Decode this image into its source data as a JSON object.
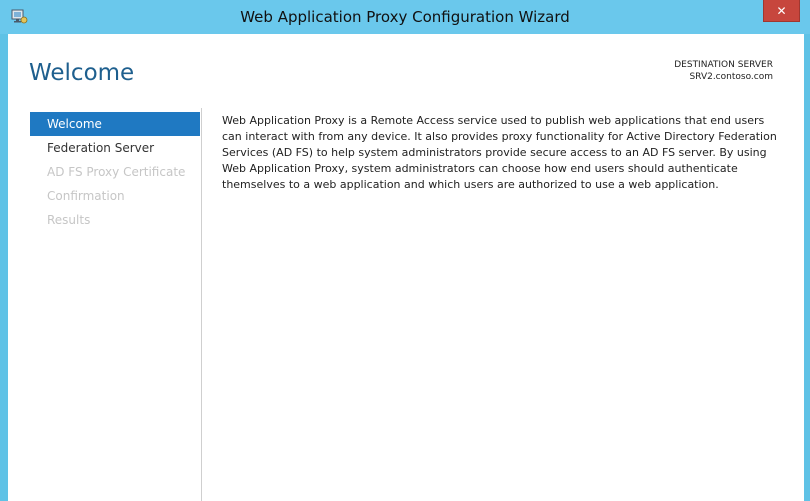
{
  "window": {
    "title": "Web Application Proxy Configuration Wizard",
    "close_glyph": "✕",
    "icon": "wizard-app-icon"
  },
  "header": {
    "page_title": "Welcome",
    "destination_label": "DESTINATION SERVER",
    "destination_value": "SRV2.contoso.com"
  },
  "nav": {
    "items": [
      {
        "label": "Welcome",
        "state": "active"
      },
      {
        "label": "Federation Server",
        "state": "enabled"
      },
      {
        "label": "AD FS Proxy Certificate",
        "state": "disabled"
      },
      {
        "label": "Confirmation",
        "state": "disabled"
      },
      {
        "label": "Results",
        "state": "disabled"
      }
    ]
  },
  "content": {
    "description": "Web Application Proxy is a Remote Access service used to publish web applications that end users can interact with from any device. It also provides proxy functionality for Active Directory Federation Services (AD FS) to help system administrators provide secure access to an AD FS server. By using Web Application Proxy, system administrators can choose how end users should authenticate themselves to a web application and which users are authorized to use a web application."
  },
  "colors": {
    "titlebar": "#6ac8ec",
    "accent": "#1f79c2",
    "close": "#c7463d"
  }
}
